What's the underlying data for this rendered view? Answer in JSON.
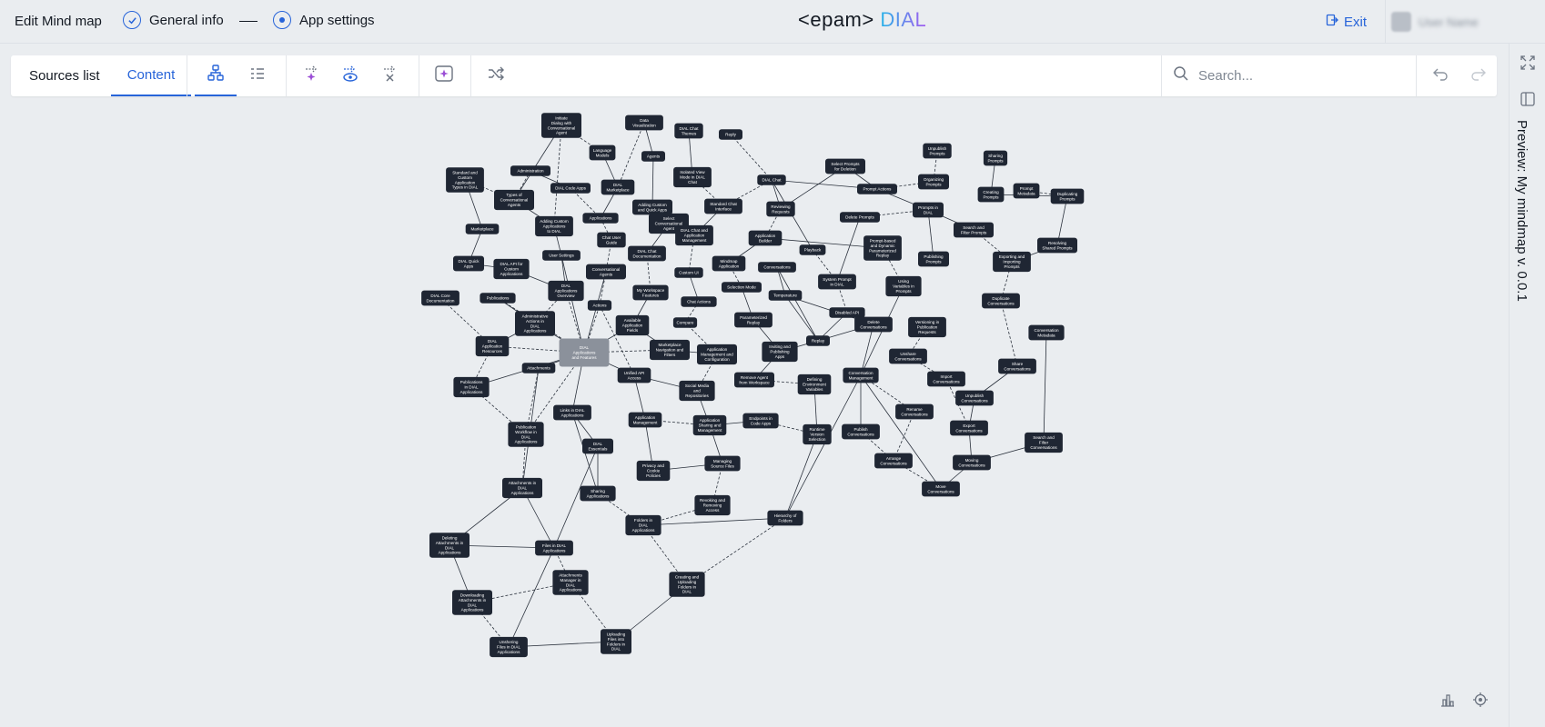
{
  "header": {
    "title": "Edit Mind map",
    "steps": [
      {
        "label": "General info"
      },
      {
        "label": "App settings"
      }
    ],
    "logo": {
      "left": "<epam>",
      "right": "DIAL"
    },
    "exit_label": "Exit",
    "user_name": "User Name"
  },
  "toolbar": {
    "tabs": [
      {
        "label": "Sources list"
      },
      {
        "label": "Content"
      }
    ],
    "active_tab": "Content",
    "view_buttons": [
      "graph-view-icon",
      "list-view-icon"
    ],
    "ai_buttons": [
      "generate-icon",
      "preview-icon",
      "clear-icon"
    ],
    "other_buttons": [
      "sparkle-box-icon",
      "shuffle-icon"
    ],
    "search_placeholder": "Search...",
    "history_buttons": [
      "undo-icon",
      "redo-icon"
    ]
  },
  "side_panel": {
    "preview_label": "Preview: My mindmap v. 0.0.1",
    "buttons": [
      "expand-icon",
      "collapse-panel-icon"
    ]
  },
  "graph": {
    "center_node": "DIAL Applications and Features",
    "nodes": [
      {
        "id": "n1",
        "label": "Initiate Dialog with Conversational Agent"
      },
      {
        "id": "n2",
        "label": "Data Visualization"
      },
      {
        "id": "n3",
        "label": "DIAL Chat Themes"
      },
      {
        "id": "n4",
        "label": "Reply"
      },
      {
        "id": "n5",
        "label": "Language Models"
      },
      {
        "id": "n6",
        "label": "Agents"
      },
      {
        "id": "n7",
        "label": "Standard and Custom Application Types in DIAL"
      },
      {
        "id": "n8",
        "label": "Administration"
      },
      {
        "id": "n9",
        "label": "DIAL Code Apps"
      },
      {
        "id": "n10",
        "label": "DIAL Marketplace"
      },
      {
        "id": "n11",
        "label": "Isolated View Mode in DIAL Chat"
      },
      {
        "id": "n12",
        "label": "DIAL Chat"
      },
      {
        "id": "n13",
        "label": "Types of Conversational Agents"
      },
      {
        "id": "n14",
        "label": "Adding Custom and Quick Apps"
      },
      {
        "id": "n15",
        "label": "Standard Chat Interface"
      },
      {
        "id": "n16",
        "label": "Reviewing Requests"
      },
      {
        "id": "n17",
        "label": "Marketplace"
      },
      {
        "id": "n18",
        "label": "Adding Custom Applications to DIAL"
      },
      {
        "id": "n19",
        "label": "Applications"
      },
      {
        "id": "n20",
        "label": "Select Conversational Agent"
      },
      {
        "id": "n21",
        "label": "DIAL Chat and Application Management"
      },
      {
        "id": "n22",
        "label": "Application Builder"
      },
      {
        "id": "n23",
        "label": "Chat User Guide"
      },
      {
        "id": "n24",
        "label": "User Settings"
      },
      {
        "id": "n25",
        "label": "DIAL Chat Documentation"
      },
      {
        "id": "n26",
        "label": "DIAL Quick Apps"
      },
      {
        "id": "n27",
        "label": "DIAL API for Custom Applications"
      },
      {
        "id": "n28",
        "label": "Conversational Agents"
      },
      {
        "id": "n29",
        "label": "Custom UI"
      },
      {
        "id": "n30",
        "label": "Mindmap Application"
      },
      {
        "id": "n31",
        "label": "Conversations"
      },
      {
        "id": "n32",
        "label": "Playback"
      },
      {
        "id": "n33",
        "label": "Publications"
      },
      {
        "id": "n34",
        "label": "DIAL Applications Overview"
      },
      {
        "id": "n35",
        "label": "My Workspace Features"
      },
      {
        "id": "n36",
        "label": "Chat Actions"
      },
      {
        "id": "n37",
        "label": "Selection Mode"
      },
      {
        "id": "n38",
        "label": "Temperature"
      },
      {
        "id": "n39",
        "label": "DIAL Core Documentation"
      },
      {
        "id": "n40",
        "label": "Administrative Actions in DIAL Applications"
      },
      {
        "id": "n41",
        "label": "Actions"
      },
      {
        "id": "n42",
        "label": "Available Application Fields"
      },
      {
        "id": "n43",
        "label": "Compare"
      },
      {
        "id": "n44",
        "label": "Parameterized Replay"
      },
      {
        "id": "n45",
        "label": "System Prompt in DIAL"
      },
      {
        "id": "n46",
        "label": "Disabled API"
      },
      {
        "id": "n47",
        "label": "Replay"
      },
      {
        "id": "n48",
        "label": "DIAL Application Resources"
      },
      {
        "id": "n49",
        "label": "Marketplace Navigation and Filters"
      },
      {
        "id": "n50",
        "label": "Application Management and Configuration"
      },
      {
        "id": "n51",
        "label": "Inviting and Publishing Apps"
      },
      {
        "id": "n52",
        "label": "Attachments"
      },
      {
        "id": "n53",
        "label": "Unified API Access"
      },
      {
        "id": "n54",
        "label": "Remove Agent from Workspace"
      },
      {
        "id": "n55",
        "label": "Defining Environment Variables"
      },
      {
        "id": "n56",
        "label": "Publications in DIAL Applications"
      },
      {
        "id": "n57",
        "label": "Social Media and Repositories"
      },
      {
        "id": "n58",
        "label": "Links in DIAL Applications"
      },
      {
        "id": "n59",
        "label": "Application Management"
      },
      {
        "id": "n60",
        "label": "Application Sharing and Management"
      },
      {
        "id": "n61",
        "label": "Endpoints in Code Apps"
      },
      {
        "id": "n62",
        "label": "Runtime Version Selection"
      },
      {
        "id": "n63",
        "label": "Publication Workflow in DIAL Applications"
      },
      {
        "id": "n64",
        "label": "DIAL Essentials"
      },
      {
        "id": "n65",
        "label": "Managing Source Files"
      },
      {
        "id": "n66",
        "label": "Privacy and Cookie Policies"
      },
      {
        "id": "n67",
        "label": "Sharing Applications"
      },
      {
        "id": "n68",
        "label": "Attachments in DIAL Applications"
      },
      {
        "id": "n69",
        "label": "Revoking and Removing Access"
      },
      {
        "id": "n70",
        "label": "Hierarchy of Folders"
      },
      {
        "id": "n71",
        "label": "Folders in DIAL Applications"
      },
      {
        "id": "n72",
        "label": "Deleting Attachments in DIAL Applications"
      },
      {
        "id": "n73",
        "label": "Files in DIAL Applications"
      },
      {
        "id": "n74",
        "label": "Attachments Manager in DIAL Applications"
      },
      {
        "id": "n75",
        "label": "Creating and Uploading Folders in DIAL Applications"
      },
      {
        "id": "n76",
        "label": "Downloading Attachments in DIAL Applications"
      },
      {
        "id": "n77",
        "label": "Uploading Files into Folders in DIAL Applications"
      },
      {
        "id": "n78",
        "label": "Unshering Files in DIAL Applications"
      },
      {
        "id": "n79",
        "label": "Select Prompts for Deletion"
      },
      {
        "id": "n80",
        "label": "Unpublish Prompts"
      },
      {
        "id": "n81",
        "label": "Sharing Prompts"
      },
      {
        "id": "n82",
        "label": "Organizing Prompts"
      },
      {
        "id": "n83",
        "label": "Prompt Actions"
      },
      {
        "id": "n84",
        "label": "Creating Prompts"
      },
      {
        "id": "n85",
        "label": "Prompt Metadata"
      },
      {
        "id": "n86",
        "label": "Duplicating Prompts"
      },
      {
        "id": "n87",
        "label": "Delete Prompts"
      },
      {
        "id": "n88",
        "label": "Prompts in DIAL"
      },
      {
        "id": "n89",
        "label": "Search and Filter Prompts"
      },
      {
        "id": "n90",
        "label": "Resolving Shared Prompts"
      },
      {
        "id": "n91",
        "label": "Prompt-based and Dynamic Parameterized Replay"
      },
      {
        "id": "n92",
        "label": "Publishing Prompts"
      },
      {
        "id": "n93",
        "label": "Exporting and Importing Prompts"
      },
      {
        "id": "n94",
        "label": "Using Variables in Prompts"
      },
      {
        "id": "n95",
        "label": "Duplicate Conversations"
      },
      {
        "id": "n96",
        "label": "Delete Conversations"
      },
      {
        "id": "n97",
        "label": "Versioning in Publication Requests"
      },
      {
        "id": "n98",
        "label": "Conversation Metadata"
      },
      {
        "id": "n99",
        "label": "Unshare Conversations"
      },
      {
        "id": "n100",
        "label": "Share Conversations"
      },
      {
        "id": "n101",
        "label": "Conversation Management"
      },
      {
        "id": "n102",
        "label": "Import Conversations"
      },
      {
        "id": "n103",
        "label": "Unpublish Conversations"
      },
      {
        "id": "n104",
        "label": "Rename Conversations"
      },
      {
        "id": "n105",
        "label": "Export Conversations"
      },
      {
        "id": "n106",
        "label": "Publish Conversations"
      },
      {
        "id": "n107",
        "label": "Search and Filter Conversations"
      },
      {
        "id": "n108",
        "label": "Arrange Conversations"
      },
      {
        "id": "n109",
        "label": "Moving Conversations"
      },
      {
        "id": "n110",
        "label": "Move Conversations"
      }
    ]
  },
  "bottom_controls": [
    "stats-icon",
    "locate-icon"
  ]
}
